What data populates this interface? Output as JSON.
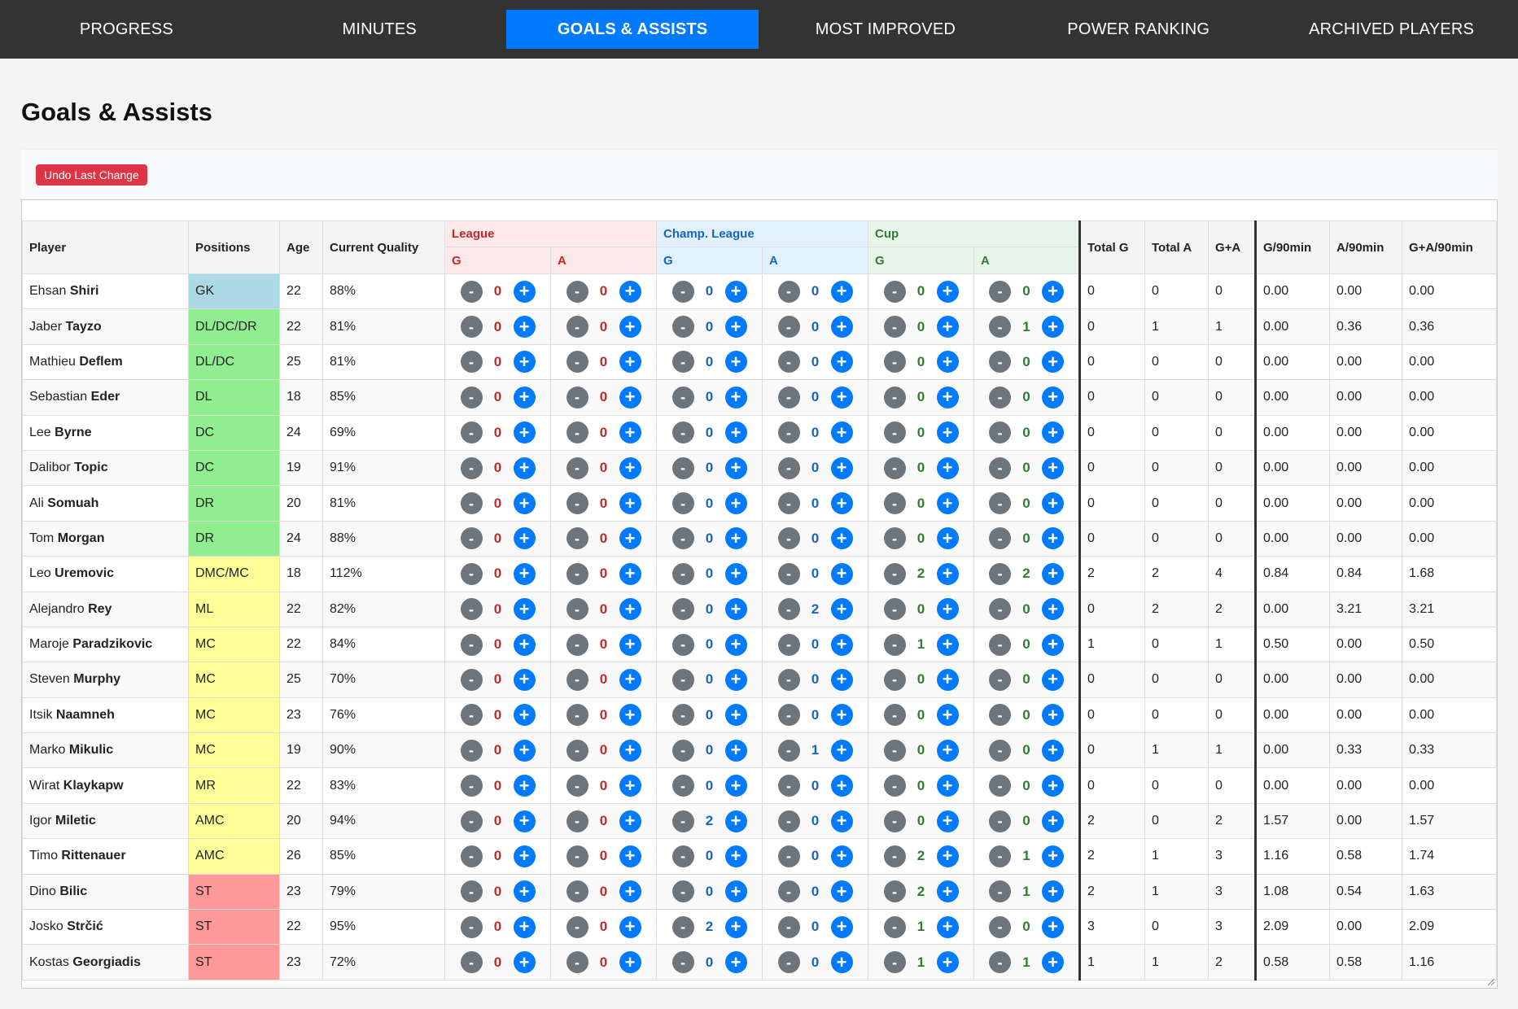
{
  "nav": {
    "tabs": [
      {
        "label": "PROGRESS",
        "active": false
      },
      {
        "label": "MINUTES",
        "active": false
      },
      {
        "label": "GOALS & ASSISTS",
        "active": true
      },
      {
        "label": "MOST IMPROVED",
        "active": false
      },
      {
        "label": "POWER RANKING",
        "active": false
      },
      {
        "label": "ARCHIVED PLAYERS",
        "active": false
      }
    ]
  },
  "page": {
    "title": "Goals & Assists",
    "undo_label": "Undo Last Change"
  },
  "table": {
    "headers": {
      "player": "Player",
      "positions": "Positions",
      "age": "Age",
      "quality": "Current Quality",
      "league": "League",
      "champ_league": "Champ. League",
      "cup": "Cup",
      "g": "G",
      "a": "A",
      "total_g": "Total G",
      "total_a": "Total A",
      "ga": "G+A",
      "g90": "G/90min",
      "a90": "A/90min",
      "ga90": "G+A/90min"
    },
    "button_minus": "-",
    "button_plus": "+",
    "rows": [
      {
        "first": "Ehsan",
        "last": "Shiri",
        "pos": "GK",
        "cat": "gk",
        "age": "22",
        "quality": "88%",
        "lg": "0",
        "la": "0",
        "cg": "0",
        "ca": "0",
        "ug": "0",
        "ua": "0",
        "tg": "0",
        "ta": "0",
        "ga": "0",
        "g90": "0.00",
        "a90": "0.00",
        "ga90": "0.00"
      },
      {
        "first": "Jaber",
        "last": "Tayzo",
        "pos": "DL/DC/DR",
        "cat": "def",
        "age": "22",
        "quality": "81%",
        "lg": "0",
        "la": "0",
        "cg": "0",
        "ca": "0",
        "ug": "0",
        "ua": "1",
        "tg": "0",
        "ta": "1",
        "ga": "1",
        "g90": "0.00",
        "a90": "0.36",
        "ga90": "0.36"
      },
      {
        "first": "Mathieu",
        "last": "Deflem",
        "pos": "DL/DC",
        "cat": "def",
        "age": "25",
        "quality": "81%",
        "lg": "0",
        "la": "0",
        "cg": "0",
        "ca": "0",
        "ug": "0",
        "ua": "0",
        "tg": "0",
        "ta": "0",
        "ga": "0",
        "g90": "0.00",
        "a90": "0.00",
        "ga90": "0.00"
      },
      {
        "first": "Sebastian",
        "last": "Eder",
        "pos": "DL",
        "cat": "def",
        "age": "18",
        "quality": "85%",
        "lg": "0",
        "la": "0",
        "cg": "0",
        "ca": "0",
        "ug": "0",
        "ua": "0",
        "tg": "0",
        "ta": "0",
        "ga": "0",
        "g90": "0.00",
        "a90": "0.00",
        "ga90": "0.00"
      },
      {
        "first": "Lee",
        "last": "Byrne",
        "pos": "DC",
        "cat": "def",
        "age": "24",
        "quality": "69%",
        "lg": "0",
        "la": "0",
        "cg": "0",
        "ca": "0",
        "ug": "0",
        "ua": "0",
        "tg": "0",
        "ta": "0",
        "ga": "0",
        "g90": "0.00",
        "a90": "0.00",
        "ga90": "0.00"
      },
      {
        "first": "Dalibor",
        "last": "Topic",
        "pos": "DC",
        "cat": "def",
        "age": "19",
        "quality": "91%",
        "lg": "0",
        "la": "0",
        "cg": "0",
        "ca": "0",
        "ug": "0",
        "ua": "0",
        "tg": "0",
        "ta": "0",
        "ga": "0",
        "g90": "0.00",
        "a90": "0.00",
        "ga90": "0.00"
      },
      {
        "first": "Ali",
        "last": "Somuah",
        "pos": "DR",
        "cat": "def",
        "age": "20",
        "quality": "81%",
        "lg": "0",
        "la": "0",
        "cg": "0",
        "ca": "0",
        "ug": "0",
        "ua": "0",
        "tg": "0",
        "ta": "0",
        "ga": "0",
        "g90": "0.00",
        "a90": "0.00",
        "ga90": "0.00"
      },
      {
        "first": "Tom",
        "last": "Morgan",
        "pos": "DR",
        "cat": "def",
        "age": "24",
        "quality": "88%",
        "lg": "0",
        "la": "0",
        "cg": "0",
        "ca": "0",
        "ug": "0",
        "ua": "0",
        "tg": "0",
        "ta": "0",
        "ga": "0",
        "g90": "0.00",
        "a90": "0.00",
        "ga90": "0.00"
      },
      {
        "first": "Leo",
        "last": "Uremovic",
        "pos": "DMC/MC",
        "cat": "mid",
        "age": "18",
        "quality": "112%",
        "lg": "0",
        "la": "0",
        "cg": "0",
        "ca": "0",
        "ug": "2",
        "ua": "2",
        "tg": "2",
        "ta": "2",
        "ga": "4",
        "g90": "0.84",
        "a90": "0.84",
        "ga90": "1.68"
      },
      {
        "first": "Alejandro",
        "last": "Rey",
        "pos": "ML",
        "cat": "mid",
        "age": "22",
        "quality": "82%",
        "lg": "0",
        "la": "0",
        "cg": "0",
        "ca": "2",
        "ug": "0",
        "ua": "0",
        "tg": "0",
        "ta": "2",
        "ga": "2",
        "g90": "0.00",
        "a90": "3.21",
        "ga90": "3.21"
      },
      {
        "first": "Maroje",
        "last": "Paradzikovic",
        "pos": "MC",
        "cat": "mid",
        "age": "22",
        "quality": "84%",
        "lg": "0",
        "la": "0",
        "cg": "0",
        "ca": "0",
        "ug": "1",
        "ua": "0",
        "tg": "1",
        "ta": "0",
        "ga": "1",
        "g90": "0.50",
        "a90": "0.00",
        "ga90": "0.50"
      },
      {
        "first": "Steven",
        "last": "Murphy",
        "pos": "MC",
        "cat": "mid",
        "age": "25",
        "quality": "70%",
        "lg": "0",
        "la": "0",
        "cg": "0",
        "ca": "0",
        "ug": "0",
        "ua": "0",
        "tg": "0",
        "ta": "0",
        "ga": "0",
        "g90": "0.00",
        "a90": "0.00",
        "ga90": "0.00"
      },
      {
        "first": "Itsik",
        "last": "Naamneh",
        "pos": "MC",
        "cat": "mid",
        "age": "23",
        "quality": "76%",
        "lg": "0",
        "la": "0",
        "cg": "0",
        "ca": "0",
        "ug": "0",
        "ua": "0",
        "tg": "0",
        "ta": "0",
        "ga": "0",
        "g90": "0.00",
        "a90": "0.00",
        "ga90": "0.00"
      },
      {
        "first": "Marko",
        "last": "Mikulic",
        "pos": "MC",
        "cat": "mid",
        "age": "19",
        "quality": "90%",
        "lg": "0",
        "la": "0",
        "cg": "0",
        "ca": "1",
        "ug": "0",
        "ua": "0",
        "tg": "0",
        "ta": "1",
        "ga": "1",
        "g90": "0.00",
        "a90": "0.33",
        "ga90": "0.33"
      },
      {
        "first": "Wirat",
        "last": "Klaykapw",
        "pos": "MR",
        "cat": "mid",
        "age": "22",
        "quality": "83%",
        "lg": "0",
        "la": "0",
        "cg": "0",
        "ca": "0",
        "ug": "0",
        "ua": "0",
        "tg": "0",
        "ta": "0",
        "ga": "0",
        "g90": "0.00",
        "a90": "0.00",
        "ga90": "0.00"
      },
      {
        "first": "Igor",
        "last": "Miletic",
        "pos": "AMC",
        "cat": "mid",
        "age": "20",
        "quality": "94%",
        "lg": "0",
        "la": "0",
        "cg": "2",
        "ca": "0",
        "ug": "0",
        "ua": "0",
        "tg": "2",
        "ta": "0",
        "ga": "2",
        "g90": "1.57",
        "a90": "0.00",
        "ga90": "1.57"
      },
      {
        "first": "Timo",
        "last": "Rittenauer",
        "pos": "AMC",
        "cat": "mid",
        "age": "26",
        "quality": "85%",
        "lg": "0",
        "la": "0",
        "cg": "0",
        "ca": "0",
        "ug": "2",
        "ua": "1",
        "tg": "2",
        "ta": "1",
        "ga": "3",
        "g90": "1.16",
        "a90": "0.58",
        "ga90": "1.74"
      },
      {
        "first": "Dino",
        "last": "Bilic",
        "pos": "ST",
        "cat": "st",
        "age": "23",
        "quality": "79%",
        "lg": "0",
        "la": "0",
        "cg": "0",
        "ca": "0",
        "ug": "2",
        "ua": "1",
        "tg": "2",
        "ta": "1",
        "ga": "3",
        "g90": "1.08",
        "a90": "0.54",
        "ga90": "1.63"
      },
      {
        "first": "Josko",
        "last": "Strčić",
        "pos": "ST",
        "cat": "st",
        "age": "22",
        "quality": "95%",
        "lg": "0",
        "la": "0",
        "cg": "2",
        "ca": "0",
        "ug": "1",
        "ua": "0",
        "tg": "3",
        "ta": "0",
        "ga": "3",
        "g90": "2.09",
        "a90": "0.00",
        "ga90": "2.09"
      },
      {
        "first": "Kostas",
        "last": "Georgiadis",
        "pos": "ST",
        "cat": "st",
        "age": "23",
        "quality": "72%",
        "lg": "0",
        "la": "0",
        "cg": "0",
        "ca": "0",
        "ug": "1",
        "ua": "1",
        "tg": "1",
        "ta": "1",
        "ga": "2",
        "g90": "0.58",
        "a90": "0.58",
        "ga90": "1.16"
      }
    ]
  }
}
